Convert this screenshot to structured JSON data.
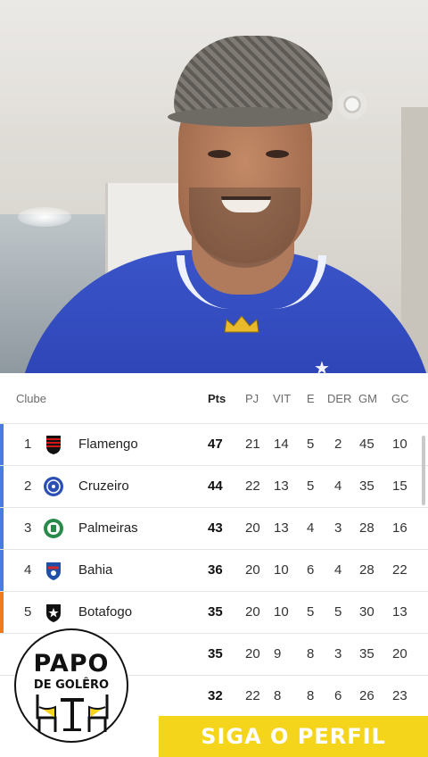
{
  "header": {
    "club": "Clube",
    "pts": "Pts",
    "pj": "PJ",
    "vit": "VIT",
    "e": "E",
    "der": "DER",
    "gm": "GM",
    "gc": "GC"
  },
  "rows": [
    {
      "pos": "1",
      "name": "Flamengo",
      "pts": "47",
      "pj": "21",
      "vit": "14",
      "e": "5",
      "der": "2",
      "gm": "45",
      "gc": "10",
      "bar_color": "#4a7be0",
      "crest": "flamengo-crest-icon"
    },
    {
      "pos": "2",
      "name": "Cruzeiro",
      "pts": "44",
      "pj": "22",
      "vit": "13",
      "e": "5",
      "der": "4",
      "gm": "35",
      "gc": "15",
      "bar_color": "#4a7be0",
      "crest": "cruzeiro-crest-icon"
    },
    {
      "pos": "3",
      "name": "Palmeiras",
      "pts": "43",
      "pj": "20",
      "vit": "13",
      "e": "4",
      "der": "3",
      "gm": "28",
      "gc": "16",
      "bar_color": "#4a7be0",
      "crest": "palmeiras-crest-icon"
    },
    {
      "pos": "4",
      "name": "Bahia",
      "pts": "36",
      "pj": "20",
      "vit": "10",
      "e": "6",
      "der": "4",
      "gm": "28",
      "gc": "22",
      "bar_color": "#4a7be0",
      "crest": "bahia-crest-icon"
    },
    {
      "pos": "5",
      "name": "Botafogo",
      "pts": "35",
      "pj": "20",
      "vit": "10",
      "e": "5",
      "der": "5",
      "gm": "30",
      "gc": "13",
      "bar_color": "#f07b1e",
      "crest": "botafogo-crest-icon"
    },
    {
      "pos": "",
      "name": "",
      "pts": "35",
      "pj": "20",
      "vit": "9",
      "e": "8",
      "der": "3",
      "gm": "35",
      "gc": "20",
      "bar_color": "",
      "crest": ""
    },
    {
      "pos": "",
      "name": "",
      "pts": "32",
      "pj": "22",
      "vit": "8",
      "e": "8",
      "der": "6",
      "gm": "26",
      "gc": "23",
      "bar_color": "",
      "crest": ""
    }
  ],
  "logo": {
    "line1": "PAPO",
    "line2": "DE GOLÊRO"
  },
  "cta": {
    "label": "SIGA O PERFIL"
  },
  "colors": {
    "cta_bg": "#f5d51c",
    "shirt": "#2f47b8",
    "champions_bar": "#4a7be0",
    "libertadores_pre_bar": "#f07b1e"
  }
}
